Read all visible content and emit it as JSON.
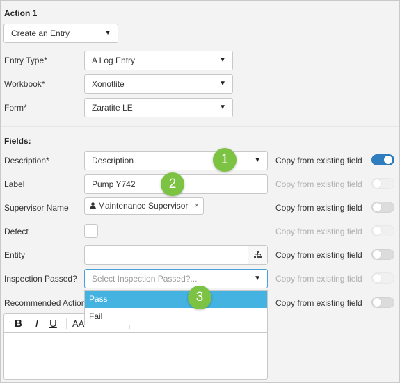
{
  "action": {
    "title": "Action 1",
    "type_value": "Create an Entry"
  },
  "entry_type": {
    "label": "Entry Type*",
    "value": "A Log Entry"
  },
  "workbook": {
    "label": "Workbook*",
    "value": "Xonotlite"
  },
  "form": {
    "label": "Form*",
    "value": "Zaratite LE"
  },
  "fields": {
    "title": "Fields:",
    "copy_label": "Copy from existing field",
    "description": {
      "label": "Description*",
      "value": "Description",
      "copy_on": true
    },
    "label_field": {
      "label": "Label",
      "value": "Pump Y742"
    },
    "supervisor": {
      "label": "Supervisor Name",
      "value": "Maintenance Supervisor",
      "remove": "×"
    },
    "defect": {
      "label": "Defect"
    },
    "entity": {
      "label": "Entity"
    },
    "inspection": {
      "label": "Inspection Passed?",
      "placeholder": "Select Inspection Passed?...",
      "options": [
        "Pass",
        "Fail"
      ],
      "highlighted": "Pass"
    },
    "recommended": {
      "label": "Recommended Action"
    }
  },
  "editor": {
    "bold": "B",
    "italic": "I",
    "underline": "U",
    "font_size": "AA"
  },
  "badges": [
    "1",
    "2",
    "3"
  ],
  "colors": {
    "toggle_on": "#2f7dbe",
    "highlight": "#44b3e2",
    "badge": "#7cc243"
  },
  "icons": {
    "caret": "caret-down-icon",
    "hierarchy": "hierarchy-icon",
    "person": "person-icon"
  }
}
